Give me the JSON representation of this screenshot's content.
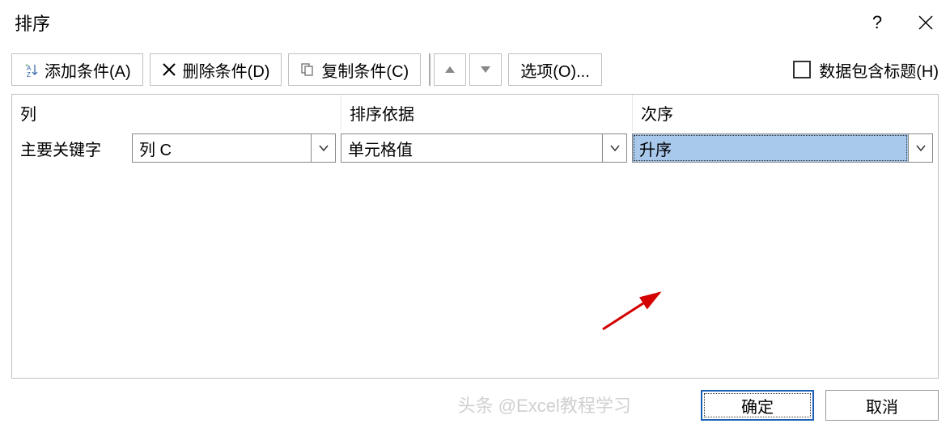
{
  "title": "排序",
  "toolbar": {
    "add": "添加条件(A)",
    "delete": "删除条件(D)",
    "copy": "复制条件(C)",
    "options": "选项(O)...",
    "header_checkbox": "数据包含标题(H)"
  },
  "headers": {
    "column": "列",
    "sort_on": "排序依据",
    "order": "次序"
  },
  "row": {
    "label": "主要关键字",
    "column_value": "列 C",
    "sort_on_value": "单元格值",
    "order_value": "升序"
  },
  "footer": {
    "ok": "确定",
    "cancel": "取消"
  },
  "watermark": "头条 @Excel教程学习"
}
